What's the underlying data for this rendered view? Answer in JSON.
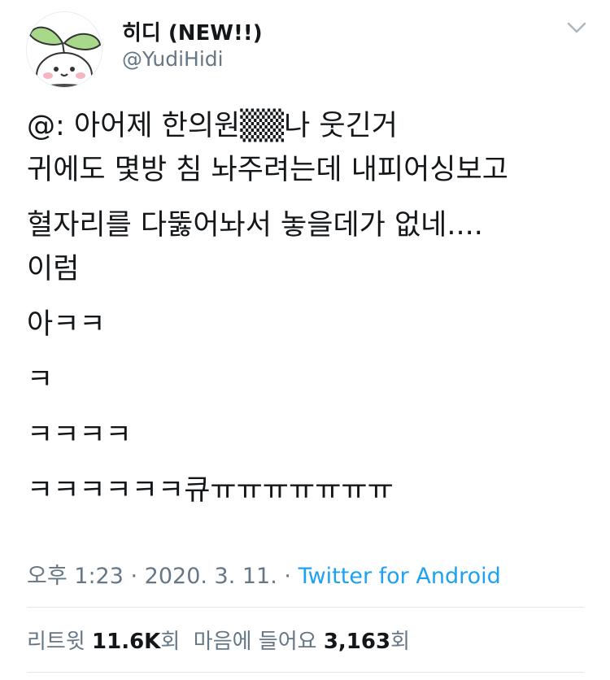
{
  "author": {
    "name": "히디 (NEW!!)",
    "handle": "@YudiHidi"
  },
  "tweet": {
    "lines": [
      "@: 아어제 한의원▒▒나 웃긴거",
      "귀에도 몇방 침 놔주려는데 내피어싱보고",
      " 혈자리를 다뚫어놔서 놓을데가 없네....",
      "이럼",
      "아ㅋㅋ",
      "ㅋ",
      "ㅋㅋㅋㅋ",
      "ㅋㅋㅋㅋㅋㅋ큐ㅠㅠㅠㅠㅠㅠㅠ"
    ]
  },
  "meta": {
    "time": "오후 1:23",
    "sep1": " · ",
    "date": "2020. 3. 11.",
    "sep2": " · ",
    "source": "Twitter for Android"
  },
  "stats": {
    "retweets_label": "리트윗",
    "retweets_count": "11.6K",
    "retweets_unit": "회",
    "likes_label": "마음에 들어요",
    "likes_count": "3,163",
    "likes_unit": "회"
  },
  "colors": {
    "text": "#14171a",
    "secondary": "#657786",
    "link": "#1da1f2",
    "divider": "#e1e8ed"
  }
}
